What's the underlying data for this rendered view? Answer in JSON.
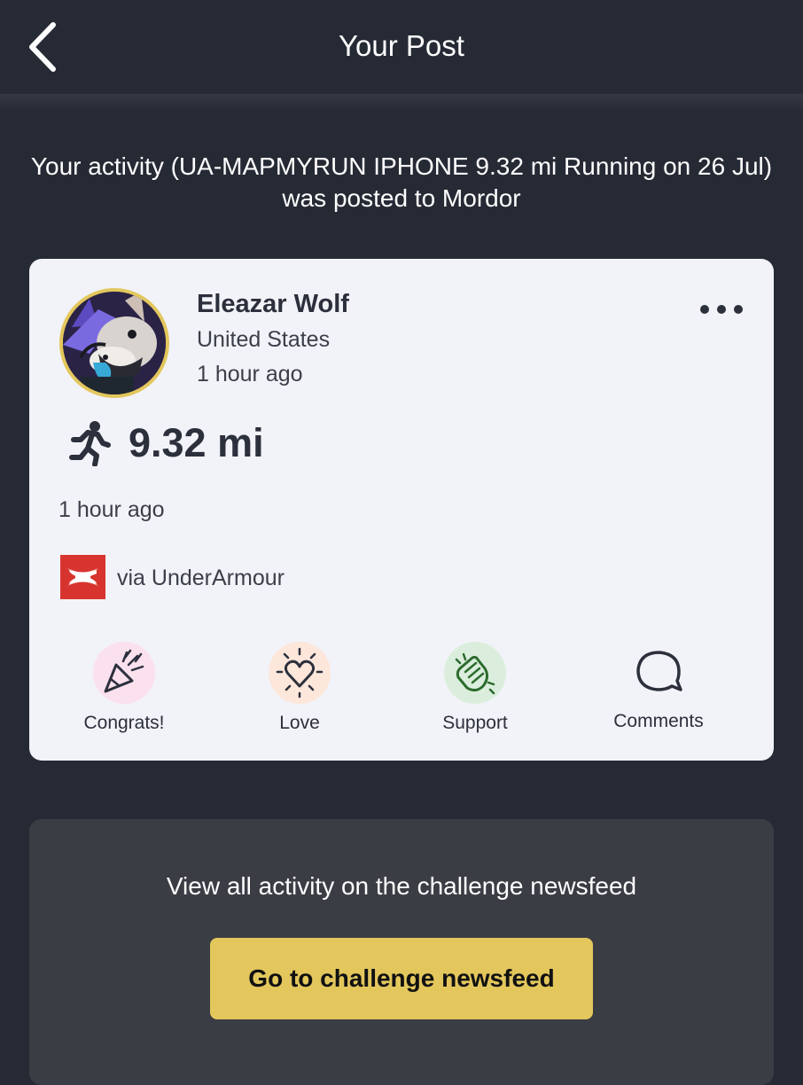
{
  "header": {
    "title": "Your Post",
    "back_icon": "chevron-left-icon"
  },
  "post_message": "Your activity (UA-MAPMYRUN IPHONE 9.32 mi Running on 26 Jul) was posted to Mordor",
  "card": {
    "user": {
      "name": "Eleazar Wolf",
      "country": "United States",
      "time": "1 hour ago",
      "avatar_ring_color": "#e3c75d"
    },
    "more_icon": "more-horizontal-icon",
    "activity": {
      "icon": "running-icon",
      "distance": "9.32 mi",
      "time": "1 hour ago"
    },
    "source": {
      "logo": "under-armour-logo",
      "logo_color": "#d8342f",
      "text": "via UnderArmour"
    },
    "reactions": [
      {
        "label": "Congrats!",
        "icon": "party-popper-icon",
        "color": "#fbe0ee"
      },
      {
        "label": "Love",
        "icon": "heart-icon",
        "color": "#fde6da"
      },
      {
        "label": "Support",
        "icon": "clapping-hands-icon",
        "color": "#dbeedd"
      },
      {
        "label": "Comments",
        "icon": "comment-bubble-icon"
      }
    ]
  },
  "cta": {
    "text": "View all activity on the challenge newsfeed",
    "button_label": "Go to challenge newsfeed",
    "button_color": "#e3c75d"
  }
}
